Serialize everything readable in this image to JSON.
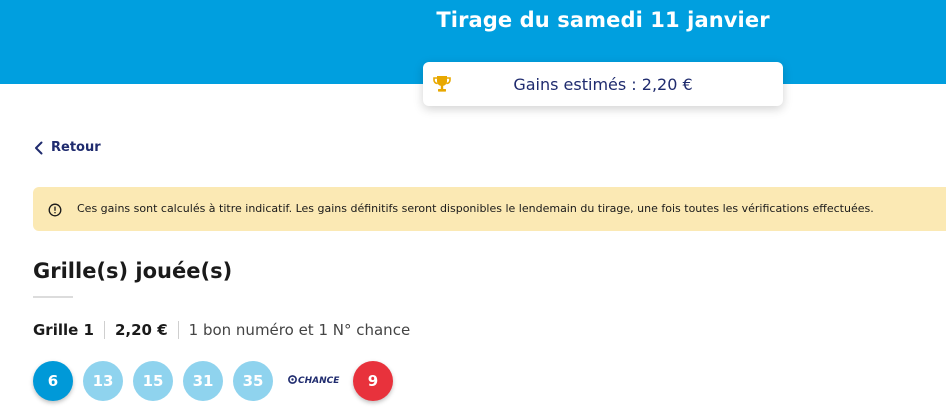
{
  "header": {
    "title": "Tirage du samedi 11 janvier",
    "gains_label": "Gains estimés : 2,20 €",
    "trophy_icon": "trophy-icon",
    "brand_color": "#009fdf"
  },
  "nav": {
    "back_label": "Retour"
  },
  "notice": {
    "icon": "info-circle-icon",
    "text": "Ces gains sont calculés à titre indicatif. Les gains définitifs seront disponibles le lendemain du tirage, une fois toutes les vérifications effectuées."
  },
  "section": {
    "title": "Grille(s) jouée(s)"
  },
  "grids": [
    {
      "name": "Grille 1",
      "amount": "2,20 €",
      "result": "1 bon numéro et 1 N° chance",
      "numbers": [
        "6",
        "13",
        "15",
        "31",
        "35"
      ],
      "chance_label": "CHANCE",
      "chance_number": "9"
    }
  ]
}
